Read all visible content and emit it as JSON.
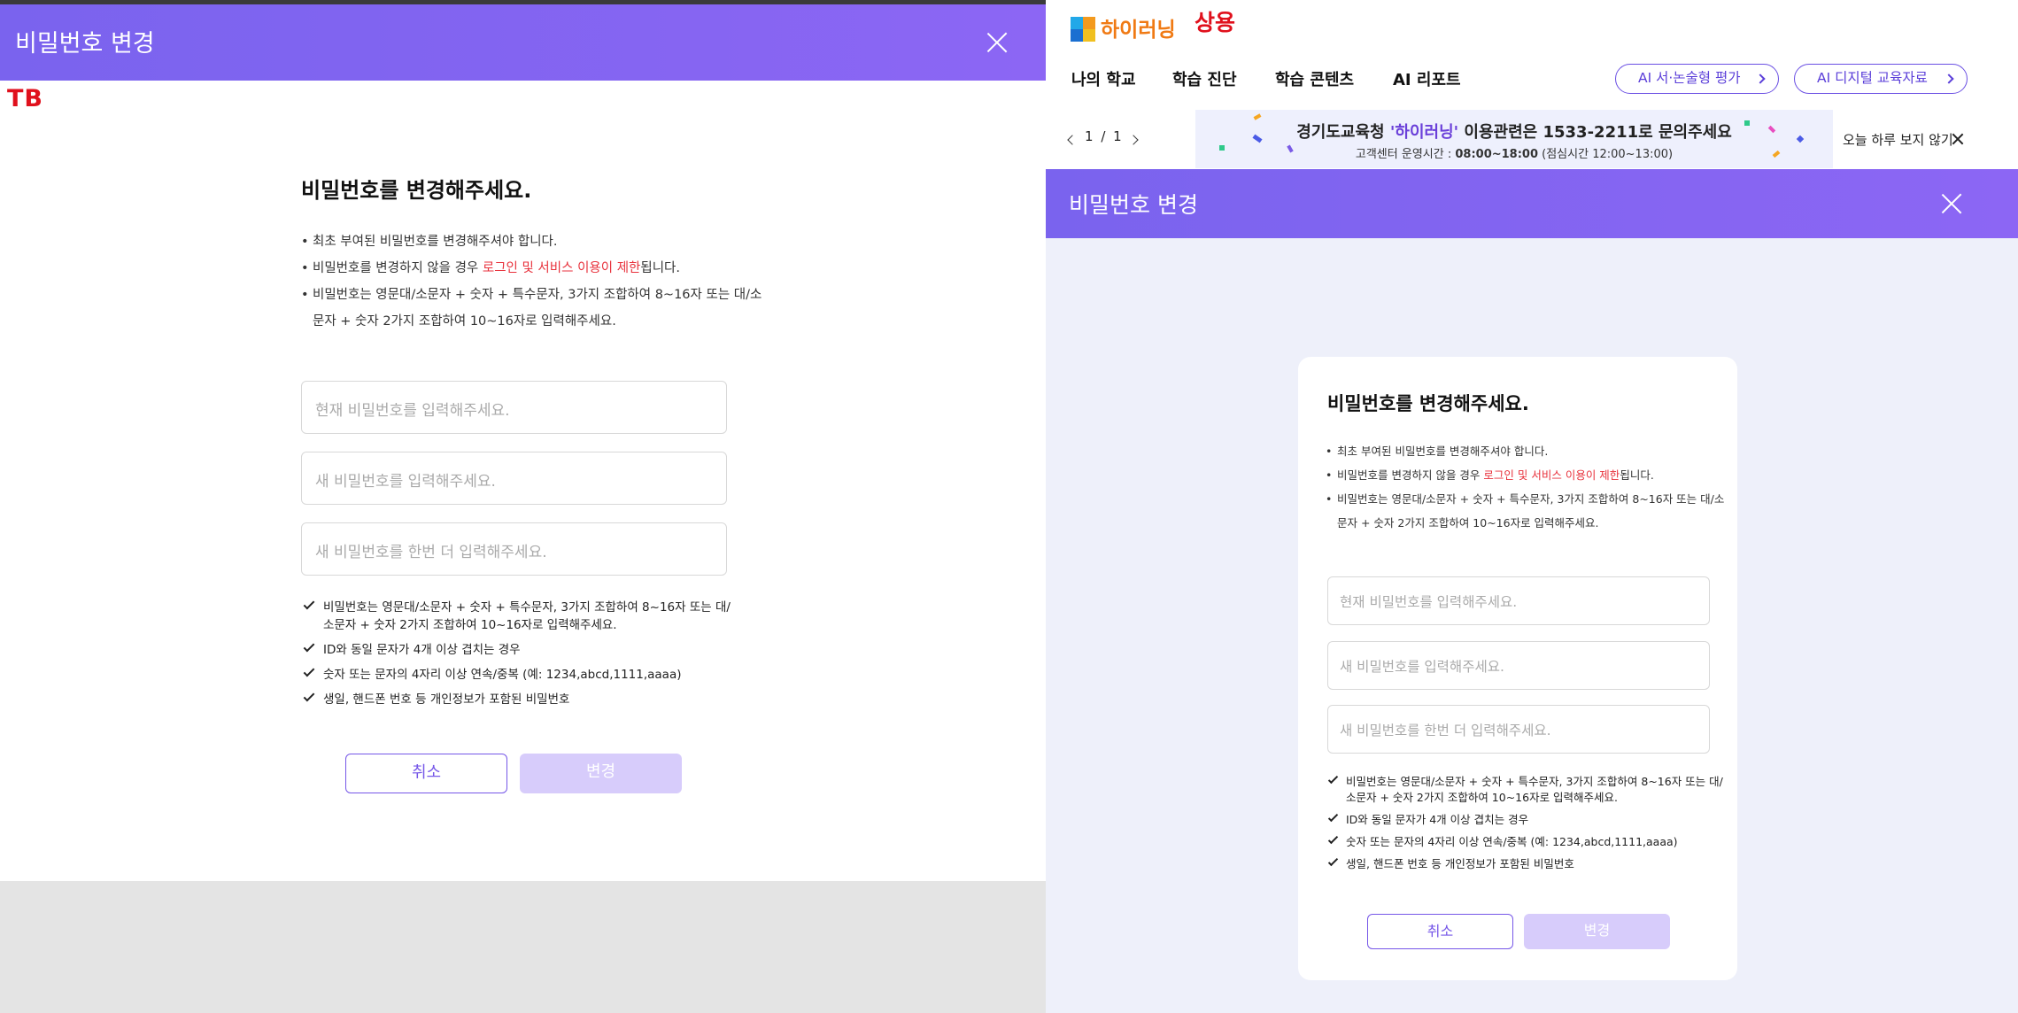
{
  "left": {
    "modal_title": "비밀번호 변경",
    "env_label": "TB"
  },
  "right": {
    "logo_text": "하이러닝",
    "env_label": "상용",
    "nav": [
      "나의 학교",
      "학습 진단",
      "학습 콘텐츠",
      "AI 리포트"
    ],
    "pills": [
      "AI 서·논술형 평가",
      "AI 디지털 교육자료"
    ],
    "pager": {
      "current": "1",
      "sep": "/",
      "total": "1"
    },
    "banner": {
      "main_prefix": "경기도교육청 ",
      "main_highlight": "'하이러닝'",
      "main_suffix": " 이용관련은 1533-2211로 문의주세요",
      "sub_prefix": "고객센터 운영시간 : ",
      "sub_hours": "08:00~18:00",
      "sub_suffix": " (점심시간 12:00~13:00)"
    },
    "dismiss_label": "오늘 하루 보지 않기",
    "modal_title": "비밀번호 변경"
  },
  "form": {
    "heading": "비밀번호를 변경해주세요.",
    "bullet1": "최초 부여된 비밀번호를 변경해주셔야 합니다.",
    "bullet2_prefix": "비밀번호를 변경하지 않을 경우 ",
    "bullet2_red": "로그인 및 서비스 이용이 제한",
    "bullet2_suffix": "됩니다.",
    "bullet3_line1": "비밀번호는 영문대/소문자 + 숫자 + 특수문자, 3가지 조합하여 8~16자 또는 대/소",
    "bullet3_line2": "문자 + 숫자 2가지 조합하여 10~16자로 입력해주세요.",
    "placeholder_current": "현재 비밀번호를 입력해주세요.",
    "placeholder_new": "새 비밀번호를 입력해주세요.",
    "placeholder_confirm": "새 비밀번호를 한번 더 입력해주세요.",
    "rule1_line1": "비밀번호는 영문대/소문자 + 숫자 + 특수문자, 3가지 조합하여 8~16자 또는 대/",
    "rule1_line2": "소문자 + 숫자 2가지 조합하여 10~16자로 입력해주세요.",
    "rule2": "ID와 동일 문자가 4개 이상 겹치는 경우",
    "rule3": "숫자 또는 문자의 4자리 이상 연속/중복 (예: 1234,abcd,1111,aaaa)",
    "rule4": "생일, 핸드폰 번호 등 개인정보가 포함된 비밀번호",
    "cancel_label": "취소",
    "change_label": "변경"
  },
  "colors": {
    "header_purple": "#7a63ee",
    "accent_purple": "#7657e8",
    "disabled_purple": "#d7ccfb",
    "warning_red": "#e8323c",
    "env_red": "#e0101c",
    "logo_orange": "#f07a14"
  }
}
